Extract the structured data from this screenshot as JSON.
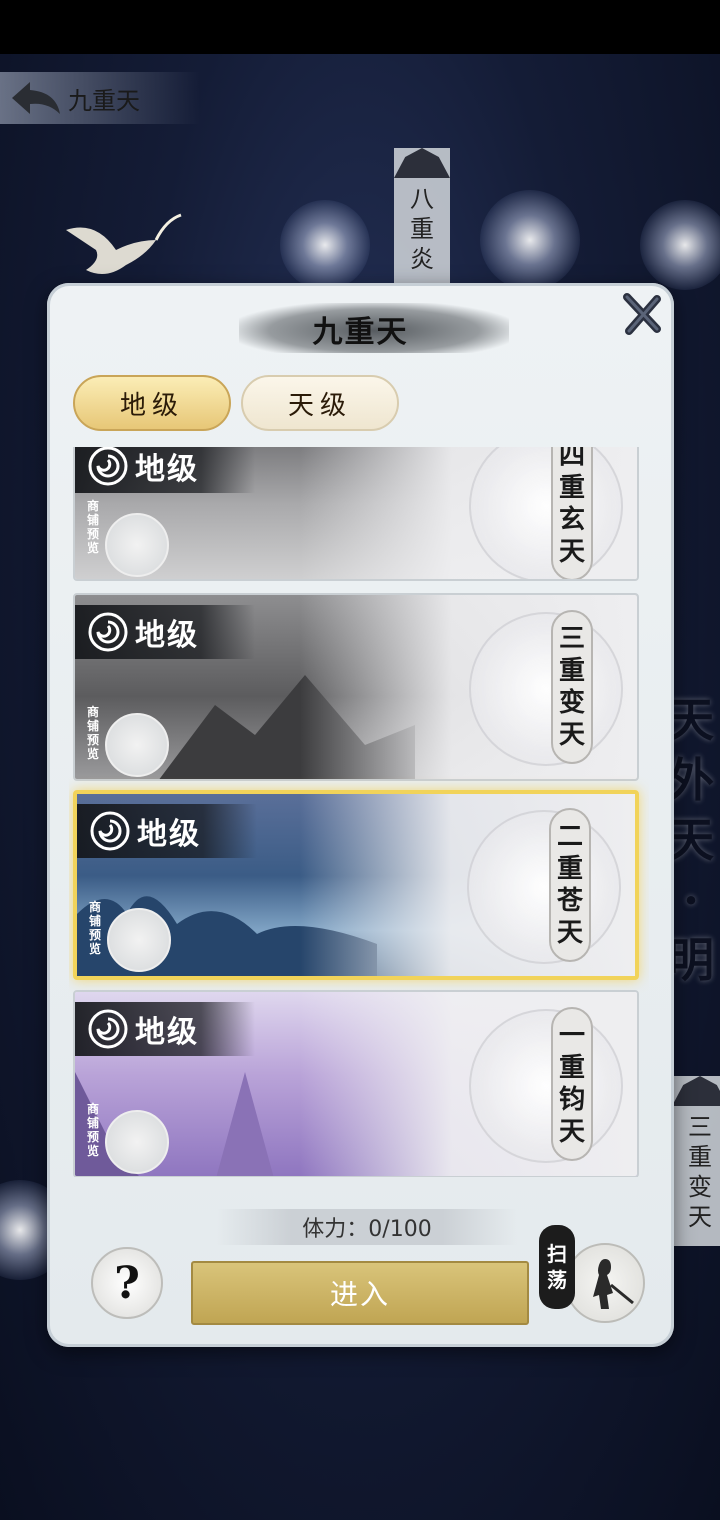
{
  "header": {
    "back_icon": "back-arrow-icon",
    "title": "九重天"
  },
  "background": {
    "pillar_top": [
      "八",
      "重",
      "炎"
    ],
    "side_text": [
      "天",
      "外",
      "天",
      "·",
      "明"
    ],
    "pillar_right": [
      "三",
      "重",
      "变",
      "天"
    ]
  },
  "dialog": {
    "title": "九重天",
    "close_icon": "close-icon",
    "tabs": [
      {
        "label": "地级",
        "active": true
      },
      {
        "label": "天级",
        "active": false
      }
    ],
    "stages": [
      {
        "grade": "地级",
        "preview": [
          "商",
          "铺",
          "预",
          "览"
        ],
        "name": [
          "四",
          "重",
          "玄",
          "天"
        ],
        "selected": false,
        "tone": "gray"
      },
      {
        "grade": "地级",
        "preview": [
          "商",
          "铺",
          "预",
          "览"
        ],
        "name": [
          "三",
          "重",
          "变",
          "天"
        ],
        "selected": false,
        "tone": "gray"
      },
      {
        "grade": "地级",
        "preview": [
          "商",
          "铺",
          "预",
          "览"
        ],
        "name": [
          "二",
          "重",
          "苍",
          "天"
        ],
        "selected": true,
        "tone": "blue"
      },
      {
        "grade": "地级",
        "preview": [
          "商",
          "铺",
          "预",
          "览"
        ],
        "name": [
          "一",
          "重",
          "钧",
          "天"
        ],
        "selected": false,
        "tone": "purple"
      }
    ],
    "stamina_text": "体力：0/100",
    "help_label": "?",
    "enter_label": "进入",
    "sweep_label": [
      "扫",
      "荡"
    ]
  },
  "colors": {
    "gold": "#e7c777",
    "selected_border": "#f1d35a",
    "panel": "#eef2f4"
  }
}
